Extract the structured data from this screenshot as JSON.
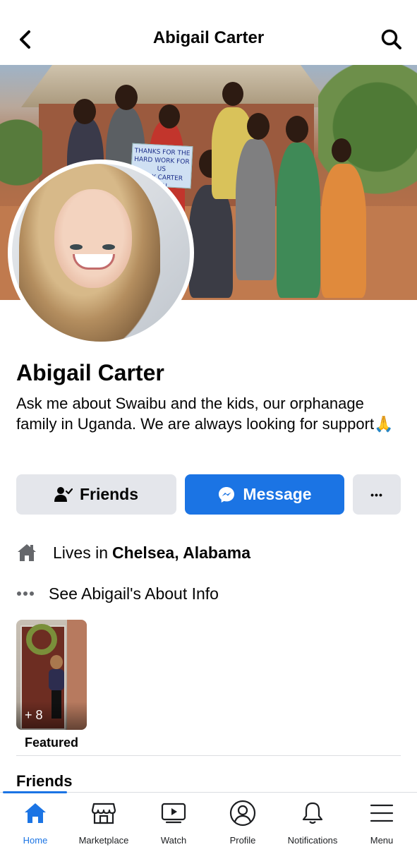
{
  "header": {
    "title": "Abigail Carter"
  },
  "cover": {
    "sign_lines": [
      "THANKS FOR THE",
      "HARD WORK FOR US",
      "ABBY CARTER",
      "YOU"
    ]
  },
  "profile": {
    "name": "Abigail Carter",
    "bio": "Ask me about Swaibu and the kids, our orphanage family in Uganda. We are always looking for support🙏"
  },
  "actions": {
    "friends_label": "Friends",
    "message_label": "Message",
    "more_label": "•••"
  },
  "info": {
    "lives_prefix": "Lives in",
    "lives_place": "Chelsea, Alabama",
    "about_label": "See Abigail's About Info"
  },
  "featured": {
    "count": "+ 8",
    "label": "Featured"
  },
  "friends_section": {
    "heading": "Friends"
  },
  "tabbar": {
    "tabs": [
      {
        "label": "Home",
        "icon": "home-icon"
      },
      {
        "label": "Marketplace",
        "icon": "marketplace-icon"
      },
      {
        "label": "Watch",
        "icon": "watch-icon"
      },
      {
        "label": "Profile",
        "icon": "profile-icon"
      },
      {
        "label": "Notifications",
        "icon": "bell-icon"
      },
      {
        "label": "Menu",
        "icon": "menu-icon"
      }
    ],
    "active_index": 0
  },
  "colors": {
    "accent": "#1b74e4",
    "button_gray": "#e4e6eb",
    "text": "#050505"
  }
}
